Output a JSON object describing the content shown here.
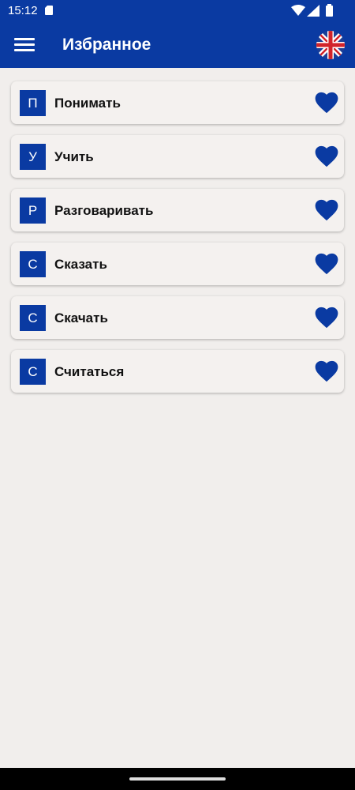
{
  "status_bar": {
    "time": "15:12"
  },
  "app_bar": {
    "title": "Избранное",
    "menu_icon": "hamburger-menu-icon",
    "language_icon": "uk-flag-icon"
  },
  "favorites": [
    {
      "letter": "П",
      "word": "Понимать"
    },
    {
      "letter": "У",
      "word": "Учить"
    },
    {
      "letter": "Р",
      "word": "Разговаривать"
    },
    {
      "letter": "С",
      "word": "Сказать"
    },
    {
      "letter": "С",
      "word": "Скачать"
    },
    {
      "letter": "С",
      "word": "Считаться"
    }
  ],
  "colors": {
    "primary": "#0a3aa2",
    "background": "#f1eeec",
    "card": "#f4f1ef"
  }
}
